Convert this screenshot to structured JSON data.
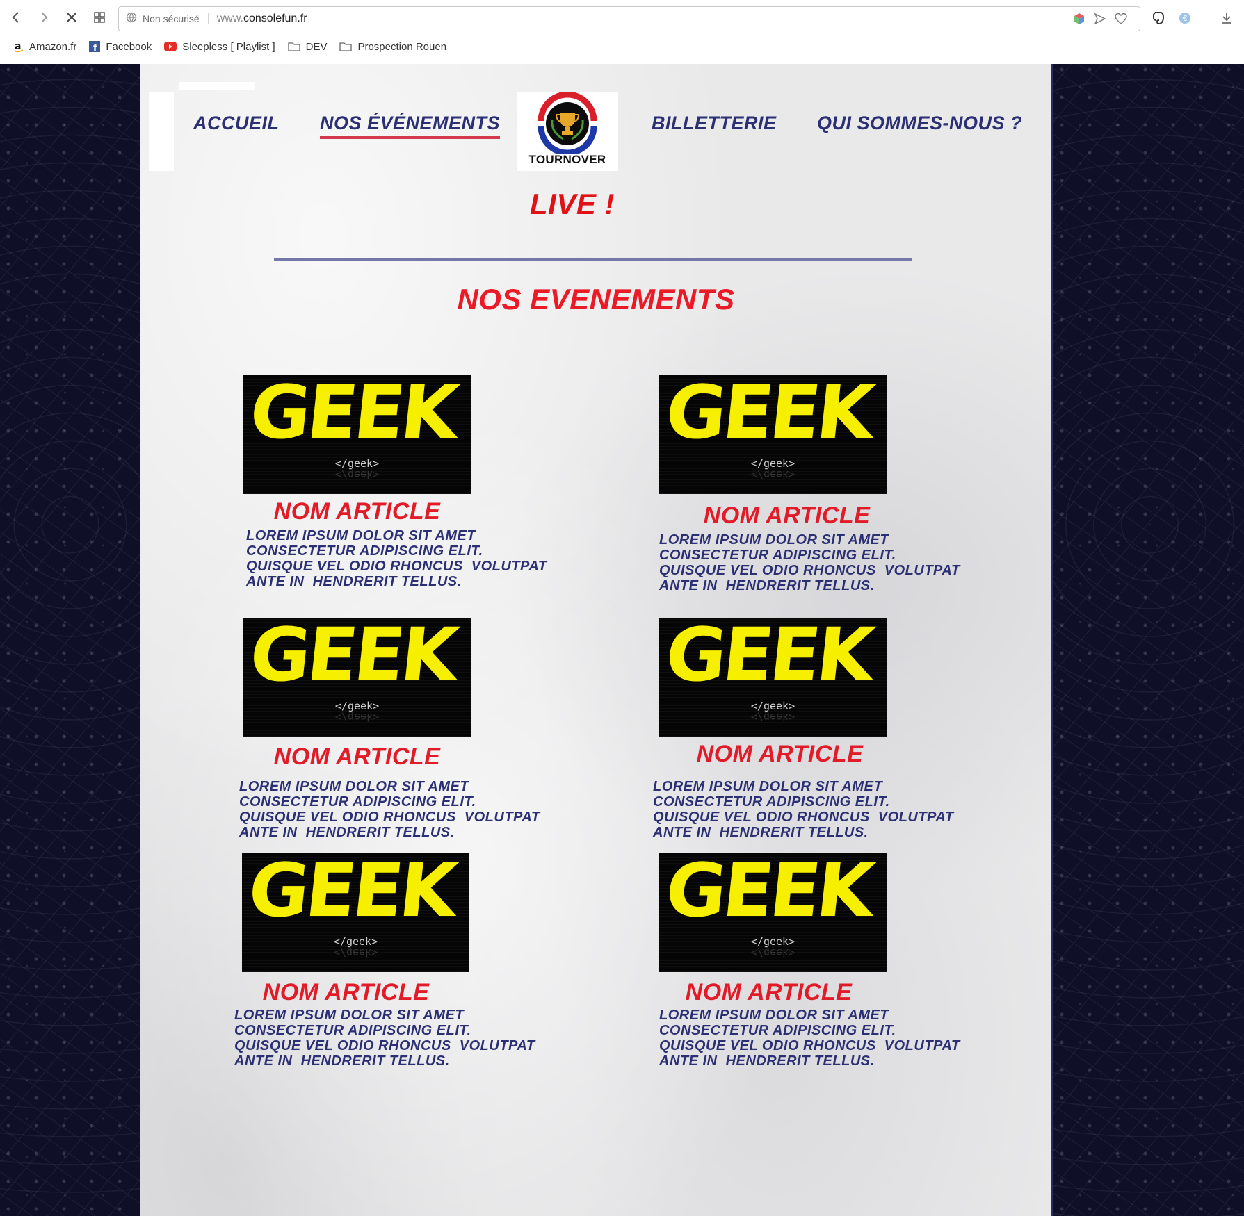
{
  "browser": {
    "security_label": "Non sécurisé",
    "url_prefix": "www.",
    "url_domain": "consolefun.fr",
    "bookmarks": [
      {
        "label": "Amazon.fr",
        "icon": "amazon-icon"
      },
      {
        "label": "Facebook",
        "icon": "facebook-icon"
      },
      {
        "label": "Sleepless [ Playlist ]",
        "icon": "youtube-icon"
      },
      {
        "label": "DEV",
        "icon": "folder-icon"
      },
      {
        "label": "Prospection Rouen",
        "icon": "folder-icon"
      }
    ]
  },
  "site": {
    "nav": {
      "home": "Accueil",
      "events": "Nos événements",
      "tickets": "Billetterie",
      "about": "Qui sommes-nous ?",
      "active": "events"
    },
    "logo_text": "TOURNOVER",
    "live": "LIVE !",
    "section_title": "NOS EVENEMENTS",
    "colors": {
      "accent_red": "#e21b28",
      "nav_blue": "#2b2f74",
      "geek_yellow": "#f6f000"
    },
    "articles": [
      {
        "image_big": "GEEK",
        "image_small": "</geek>",
        "title": "NOM ARTICLE",
        "text": "LOREM IPSUM DOLOR SIT AMET\nCONSECTETUR ADIPISCING ELIT.\nQUISQUE VEL ODIO RHONCUS  VOLUTPAT\nANTE IN  HENDRERIT TELLUS."
      },
      {
        "image_big": "GEEK",
        "image_small": "</geek>",
        "title": "NOM ARTICLE",
        "text": "LOREM IPSUM DOLOR SIT AMET\nCONSECTETUR ADIPISCING ELIT.\nQUISQUE VEL ODIO RHONCUS  VOLUTPAT\nANTE IN  HENDRERIT TELLUS."
      },
      {
        "image_big": "GEEK",
        "image_small": "</geek>",
        "title": "NOM ARTICLE",
        "text": "LOREM IPSUM DOLOR SIT AMET\nCONSECTETUR ADIPISCING ELIT.\nQUISQUE VEL ODIO RHONCUS  VOLUTPAT\nANTE IN  HENDRERIT TELLUS."
      },
      {
        "image_big": "GEEK",
        "image_small": "</geek>",
        "title": "NOM ARTICLE",
        "text": "LOREM IPSUM DOLOR SIT AMET\nCONSECTETUR ADIPISCING ELIT.\nQUISQUE VEL ODIO RHONCUS  VOLUTPAT\nANTE IN  HENDRERIT TELLUS."
      },
      {
        "image_big": "GEEK",
        "image_small": "</geek>",
        "title": "NOM ARTICLE",
        "text": "LOREM IPSUM DOLOR SIT AMET\nCONSECTETUR ADIPISCING ELIT.\nQUISQUE VEL ODIO RHONCUS  VOLUTPAT\nANTE IN  HENDRERIT TELLUS."
      },
      {
        "image_big": "GEEK",
        "image_small": "</geek>",
        "title": "NOM ARTICLE",
        "text": "LOREM IPSUM DOLOR SIT AMET\nCONSECTETUR ADIPISCING ELIT.\nQUISQUE VEL ODIO RHONCUS  VOLUTPAT\nANTE IN  HENDRERIT TELLUS."
      }
    ]
  }
}
